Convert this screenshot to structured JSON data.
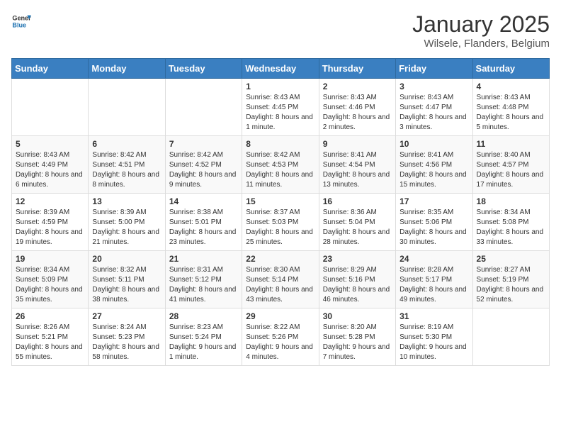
{
  "logo": {
    "text_general": "General",
    "text_blue": "Blue"
  },
  "header": {
    "month_year": "January 2025",
    "location": "Wilsele, Flanders, Belgium"
  },
  "weekdays": [
    "Sunday",
    "Monday",
    "Tuesday",
    "Wednesday",
    "Thursday",
    "Friday",
    "Saturday"
  ],
  "weeks": [
    [
      {
        "day": "",
        "text": ""
      },
      {
        "day": "",
        "text": ""
      },
      {
        "day": "",
        "text": ""
      },
      {
        "day": "1",
        "text": "Sunrise: 8:43 AM\nSunset: 4:45 PM\nDaylight: 8 hours and 1 minute."
      },
      {
        "day": "2",
        "text": "Sunrise: 8:43 AM\nSunset: 4:46 PM\nDaylight: 8 hours and 2 minutes."
      },
      {
        "day": "3",
        "text": "Sunrise: 8:43 AM\nSunset: 4:47 PM\nDaylight: 8 hours and 3 minutes."
      },
      {
        "day": "4",
        "text": "Sunrise: 8:43 AM\nSunset: 4:48 PM\nDaylight: 8 hours and 5 minutes."
      }
    ],
    [
      {
        "day": "5",
        "text": "Sunrise: 8:43 AM\nSunset: 4:49 PM\nDaylight: 8 hours and 6 minutes."
      },
      {
        "day": "6",
        "text": "Sunrise: 8:42 AM\nSunset: 4:51 PM\nDaylight: 8 hours and 8 minutes."
      },
      {
        "day": "7",
        "text": "Sunrise: 8:42 AM\nSunset: 4:52 PM\nDaylight: 8 hours and 9 minutes."
      },
      {
        "day": "8",
        "text": "Sunrise: 8:42 AM\nSunset: 4:53 PM\nDaylight: 8 hours and 11 minutes."
      },
      {
        "day": "9",
        "text": "Sunrise: 8:41 AM\nSunset: 4:54 PM\nDaylight: 8 hours and 13 minutes."
      },
      {
        "day": "10",
        "text": "Sunrise: 8:41 AM\nSunset: 4:56 PM\nDaylight: 8 hours and 15 minutes."
      },
      {
        "day": "11",
        "text": "Sunrise: 8:40 AM\nSunset: 4:57 PM\nDaylight: 8 hours and 17 minutes."
      }
    ],
    [
      {
        "day": "12",
        "text": "Sunrise: 8:39 AM\nSunset: 4:59 PM\nDaylight: 8 hours and 19 minutes."
      },
      {
        "day": "13",
        "text": "Sunrise: 8:39 AM\nSunset: 5:00 PM\nDaylight: 8 hours and 21 minutes."
      },
      {
        "day": "14",
        "text": "Sunrise: 8:38 AM\nSunset: 5:01 PM\nDaylight: 8 hours and 23 minutes."
      },
      {
        "day": "15",
        "text": "Sunrise: 8:37 AM\nSunset: 5:03 PM\nDaylight: 8 hours and 25 minutes."
      },
      {
        "day": "16",
        "text": "Sunrise: 8:36 AM\nSunset: 5:04 PM\nDaylight: 8 hours and 28 minutes."
      },
      {
        "day": "17",
        "text": "Sunrise: 8:35 AM\nSunset: 5:06 PM\nDaylight: 8 hours and 30 minutes."
      },
      {
        "day": "18",
        "text": "Sunrise: 8:34 AM\nSunset: 5:08 PM\nDaylight: 8 hours and 33 minutes."
      }
    ],
    [
      {
        "day": "19",
        "text": "Sunrise: 8:34 AM\nSunset: 5:09 PM\nDaylight: 8 hours and 35 minutes."
      },
      {
        "day": "20",
        "text": "Sunrise: 8:32 AM\nSunset: 5:11 PM\nDaylight: 8 hours and 38 minutes."
      },
      {
        "day": "21",
        "text": "Sunrise: 8:31 AM\nSunset: 5:12 PM\nDaylight: 8 hours and 41 minutes."
      },
      {
        "day": "22",
        "text": "Sunrise: 8:30 AM\nSunset: 5:14 PM\nDaylight: 8 hours and 43 minutes."
      },
      {
        "day": "23",
        "text": "Sunrise: 8:29 AM\nSunset: 5:16 PM\nDaylight: 8 hours and 46 minutes."
      },
      {
        "day": "24",
        "text": "Sunrise: 8:28 AM\nSunset: 5:17 PM\nDaylight: 8 hours and 49 minutes."
      },
      {
        "day": "25",
        "text": "Sunrise: 8:27 AM\nSunset: 5:19 PM\nDaylight: 8 hours and 52 minutes."
      }
    ],
    [
      {
        "day": "26",
        "text": "Sunrise: 8:26 AM\nSunset: 5:21 PM\nDaylight: 8 hours and 55 minutes."
      },
      {
        "day": "27",
        "text": "Sunrise: 8:24 AM\nSunset: 5:23 PM\nDaylight: 8 hours and 58 minutes."
      },
      {
        "day": "28",
        "text": "Sunrise: 8:23 AM\nSunset: 5:24 PM\nDaylight: 9 hours and 1 minute."
      },
      {
        "day": "29",
        "text": "Sunrise: 8:22 AM\nSunset: 5:26 PM\nDaylight: 9 hours and 4 minutes."
      },
      {
        "day": "30",
        "text": "Sunrise: 8:20 AM\nSunset: 5:28 PM\nDaylight: 9 hours and 7 minutes."
      },
      {
        "day": "31",
        "text": "Sunrise: 8:19 AM\nSunset: 5:30 PM\nDaylight: 9 hours and 10 minutes."
      },
      {
        "day": "",
        "text": ""
      }
    ]
  ]
}
